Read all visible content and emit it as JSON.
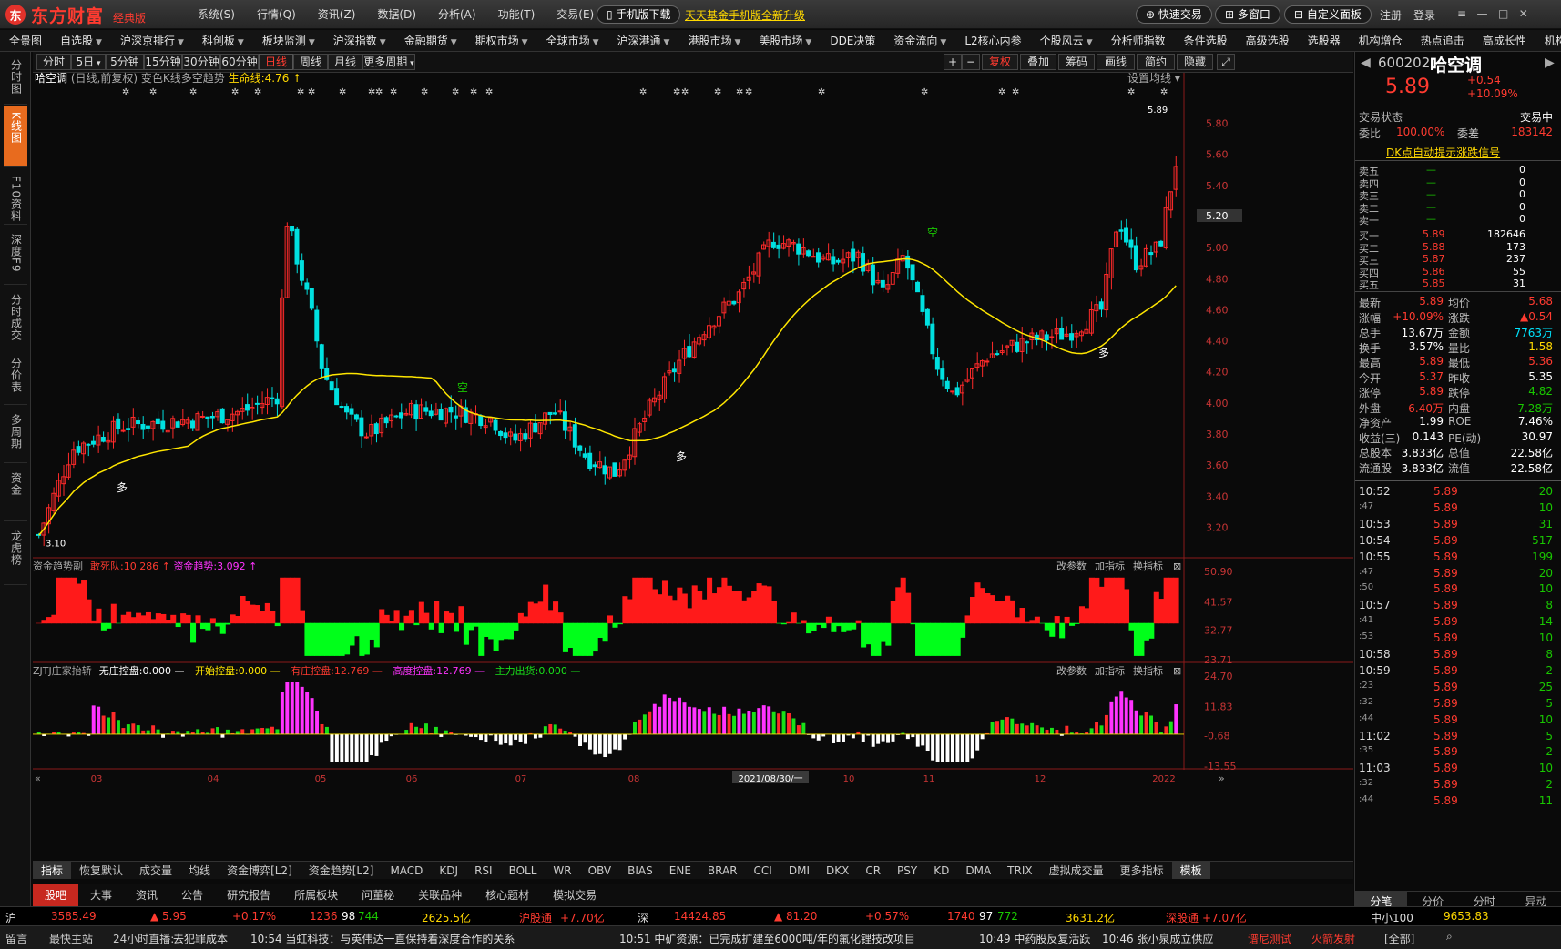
{
  "app": {
    "brand": "东方财富",
    "edition": "经典版"
  },
  "top_menu": [
    "系统(S)",
    "行情(Q)",
    "资讯(Z)",
    "数据(D)",
    "分析(A)",
    "功能(T)",
    "交易(E)",
    "帮助(H)"
  ],
  "top_links": {
    "mobile_download": "手机版下载",
    "fund_upgrade": "天天基金手机版全新升级"
  },
  "top_right": {
    "quick_trade": "快速交易",
    "multi_window": "多窗口",
    "custom_panel": "自定义面板",
    "register": "注册",
    "login": "登录"
  },
  "nav": [
    {
      "label": "全景图",
      "dd": false
    },
    {
      "label": "自选股",
      "dd": true
    },
    {
      "label": "沪深京排行",
      "dd": true
    },
    {
      "label": "科创板",
      "dd": true
    },
    {
      "label": "板块监测",
      "dd": true
    },
    {
      "label": "沪深指数",
      "dd": true
    },
    {
      "label": "金融期货",
      "dd": true
    },
    {
      "label": "期权市场",
      "dd": true
    },
    {
      "label": "全球市场",
      "dd": true
    },
    {
      "label": "沪深港通",
      "dd": true
    },
    {
      "label": "港股市场",
      "dd": true
    },
    {
      "label": "美股市场",
      "dd": true
    },
    {
      "label": "DDE决策",
      "dd": false
    },
    {
      "label": "资金流向",
      "dd": true
    },
    {
      "label": "L2核心内参",
      "dd": false
    },
    {
      "label": "个股风云",
      "dd": true
    },
    {
      "label": "分析师指数",
      "dd": false
    },
    {
      "label": "条件选股",
      "dd": false
    },
    {
      "label": "高级选股",
      "dd": false
    },
    {
      "label": "选股器",
      "dd": false
    },
    {
      "label": "机构增仓",
      "dd": false
    },
    {
      "label": "热点追击",
      "dd": false
    },
    {
      "label": "高成长性",
      "dd": false
    },
    {
      "label": "机构",
      "dd": false
    }
  ],
  "left_tabs": [
    "分时图",
    "K线图",
    "F10资料",
    "深度F9",
    "分时成交",
    "分价表",
    "多周期",
    "资金",
    "龙虎榜"
  ],
  "periods": [
    "分时",
    "5日",
    "5分钟",
    "15分钟",
    "30分钟",
    "60分钟",
    "日线",
    "周线",
    "月线",
    "更多周期"
  ],
  "period_selected": "日线",
  "chart_tools": [
    "复权",
    "叠加",
    "筹码",
    "画线",
    "简约",
    "隐藏"
  ],
  "chart_header": {
    "stock_name": "哈空调",
    "period_info": "(日线,前复权)",
    "indicator": "变色K线多空趋势",
    "life_line_label": "生命线:",
    "life_line_value": "4.76",
    "set_ma": "设置均线"
  },
  "chart_data": [
    {
      "type": "candlestick",
      "name": "main",
      "ylim": [
        3.05,
        5.95
      ],
      "yticks": [
        "5.80",
        "5.60",
        "5.40",
        "5.20",
        "5.00",
        "4.80",
        "4.60",
        "4.40",
        "4.20",
        "4.00",
        "3.80",
        "3.60",
        "3.40",
        "3.20"
      ],
      "xticks": [
        "03",
        "04",
        "05",
        "06",
        "07",
        "08",
        "2021/08/30/一",
        "10",
        "11",
        "12",
        "2022"
      ],
      "last_price_marker": "5.20",
      "hi_label": "5.89",
      "lo_label": "3.10",
      "annotations": [
        "多",
        "空",
        "多",
        "空",
        "多"
      ]
    },
    {
      "type": "area",
      "name": "资金趋势副",
      "legend": [
        {
          "label": "敢死队:",
          "value": "10.286"
        },
        {
          "label": "资金趋势:",
          "value": "3.092"
        }
      ],
      "ylim": [
        23.71,
        50.9
      ],
      "yticks": [
        "50.90",
        "41.57",
        "32.77",
        "23.71"
      ]
    },
    {
      "type": "bar",
      "name": "ZJTJ庄家抬轿",
      "legend": [
        {
          "label": "无庄控盘:",
          "value": "0.000"
        },
        {
          "label": "开始控盘:",
          "value": "0.000"
        },
        {
          "label": "有庄控盘:",
          "value": "12.769"
        },
        {
          "label": "高度控盘:",
          "value": "12.769"
        },
        {
          "label": "主力出货:",
          "value": "0.000"
        }
      ],
      "ylim": [
        -13.55,
        24.7
      ],
      "yticks": [
        "24.70",
        "11.83",
        "-0.68",
        "-13.55"
      ]
    }
  ],
  "sub_buttons": [
    "改参数",
    "加指标",
    "换指标"
  ],
  "indicators": [
    "指标",
    "恢复默认",
    "成交量",
    "均线",
    "资金博弈[L2]",
    "资金趋势[L2]",
    "MACD",
    "KDJ",
    "RSI",
    "BOLL",
    "WR",
    "OBV",
    "BIAS",
    "ENE",
    "BRAR",
    "CCI",
    "DMI",
    "DKX",
    "CR",
    "PSY",
    "KD",
    "DMA",
    "TRIX",
    "虚拟成交量",
    "更多指标",
    "模板"
  ],
  "bottom_tabs": [
    "股吧",
    "大事",
    "资讯",
    "公告",
    "研究报告",
    "所属板块",
    "问董秘",
    "关联品种",
    "核心题材",
    "模拟交易"
  ],
  "quote": {
    "code": "600202",
    "name": "哈空调",
    "price": "5.89",
    "change": "+0.54",
    "change_pct": "+10.09%",
    "trade_status_label": "交易状态",
    "trade_status": "交易中",
    "weibi_label": "委比",
    "weibi": "100.00%",
    "weicha_label": "委差",
    "weicha": "183142",
    "dk_signal": "DK点自动提示涨跌信号",
    "asks": [
      {
        "label": "卖五",
        "price": "—",
        "vol": "0"
      },
      {
        "label": "卖四",
        "price": "—",
        "vol": "0"
      },
      {
        "label": "卖三",
        "price": "—",
        "vol": "0"
      },
      {
        "label": "卖二",
        "price": "—",
        "vol": "0"
      },
      {
        "label": "卖一",
        "price": "—",
        "vol": "0"
      }
    ],
    "bids": [
      {
        "label": "买一",
        "price": "5.89",
        "vol": "182646"
      },
      {
        "label": "买二",
        "price": "5.88",
        "vol": "173"
      },
      {
        "label": "买三",
        "price": "5.87",
        "vol": "237"
      },
      {
        "label": "买四",
        "price": "5.86",
        "vol": "55"
      },
      {
        "label": "买五",
        "price": "5.85",
        "vol": "31"
      }
    ],
    "stats": [
      {
        "l1": "最新",
        "v1": "5.89",
        "c1": "red",
        "l2": "均价",
        "v2": "5.68",
        "c2": "red"
      },
      {
        "l1": "涨幅",
        "v1": "+10.09%",
        "c1": "red",
        "l2": "涨跌",
        "v2": "▲0.54",
        "c2": "red"
      },
      {
        "l1": "总手",
        "v1": "13.67万",
        "c1": "white",
        "l2": "金额",
        "v2": "7763万",
        "c2": "cyan"
      },
      {
        "l1": "换手",
        "v1": "3.57%",
        "c1": "white",
        "l2": "量比",
        "v2": "1.58",
        "c2": "yellow"
      },
      {
        "l1": "最高",
        "v1": "5.89",
        "c1": "red",
        "l2": "最低",
        "v2": "5.36",
        "c2": "red"
      },
      {
        "l1": "今开",
        "v1": "5.37",
        "c1": "red",
        "l2": "昨收",
        "v2": "5.35",
        "c2": "white"
      },
      {
        "l1": "涨停",
        "v1": "5.89",
        "c1": "red",
        "l2": "跌停",
        "v2": "4.82",
        "c2": "green"
      },
      {
        "l1": "外盘",
        "v1": "6.40万",
        "c1": "red",
        "l2": "内盘",
        "v2": "7.28万",
        "c2": "green"
      },
      {
        "l1": "净资产",
        "v1": "1.99",
        "c1": "white",
        "l2": "ROE",
        "v2": "7.46%",
        "c2": "white"
      },
      {
        "l1": "收益(三)",
        "v1": "0.143",
        "c1": "white",
        "l2": "PE(动)",
        "v2": "30.97",
        "c2": "white"
      },
      {
        "l1": "总股本",
        "v1": "3.833亿",
        "c1": "white",
        "l2": "总值",
        "v2": "22.58亿",
        "c2": "white"
      },
      {
        "l1": "流通股",
        "v1": "3.833亿",
        "c1": "white",
        "l2": "流值",
        "v2": "22.58亿",
        "c2": "white"
      }
    ],
    "ticks": [
      {
        "t": "10:52",
        "p": "5.89",
        "v": "20"
      },
      {
        "t": ":47",
        "p": "5.89",
        "v": "10"
      },
      {
        "t": "10:53",
        "p": "5.89",
        "v": "31"
      },
      {
        "t": "10:54",
        "p": "5.89",
        "v": "517"
      },
      {
        "t": "10:55",
        "p": "5.89",
        "v": "199"
      },
      {
        "t": ":47",
        "p": "5.89",
        "v": "20"
      },
      {
        "t": ":50",
        "p": "5.89",
        "v": "10"
      },
      {
        "t": "10:57",
        "p": "5.89",
        "v": "8"
      },
      {
        "t": ":41",
        "p": "5.89",
        "v": "14"
      },
      {
        "t": ":53",
        "p": "5.89",
        "v": "10"
      },
      {
        "t": "10:58",
        "p": "5.89",
        "v": "8"
      },
      {
        "t": "10:59",
        "p": "5.89",
        "v": "2"
      },
      {
        "t": ":23",
        "p": "5.89",
        "v": "25"
      },
      {
        "t": ":32",
        "p": "5.89",
        "v": "5"
      },
      {
        "t": ":44",
        "p": "5.89",
        "v": "10"
      },
      {
        "t": "11:02",
        "p": "5.89",
        "v": "5"
      },
      {
        "t": ":35",
        "p": "5.89",
        "v": "2"
      },
      {
        "t": "11:03",
        "p": "5.89",
        "v": "10"
      },
      {
        "t": ":32",
        "p": "5.89",
        "v": "2"
      },
      {
        "t": ":44",
        "p": "5.89",
        "v": "11"
      }
    ],
    "detail_tabs": [
      "分笔",
      "分价",
      "分时",
      "异动"
    ]
  },
  "status": {
    "sh_label": "沪",
    "sh_index": "3585.49",
    "sh_chg": "▲ 5.95",
    "sh_pct": "+0.17%",
    "sh_up": "1236",
    "sh_flat": "98",
    "sh_down": "744",
    "sh_amt": "2625.5亿",
    "hgt_label": "沪股通",
    "hgt": "+7.70亿",
    "sz_label": "深",
    "sz_index": "14424.85",
    "sz_chg": "▲ 81.20",
    "sz_pct": "+0.57%",
    "sz_up": "1740",
    "sz_flat": "97",
    "sz_down": "772",
    "sz_amt": "3631.2亿",
    "sgt_label": "深股通",
    "sgt": "+7.07亿",
    "zx_label": "中小100",
    "zx": "9653.83"
  },
  "news": {
    "left_items": [
      "留言",
      "最快主站",
      "24小时直播:"
    ],
    "items": [
      "去犯罪成本",
      "10:54 当虹科技：与英伟达一直保持着深度合作的关系",
      "10:51 中矿资源：已完成扩建至6000吨/年的氟化锂技改项目",
      "10:49 中药股反复活跃",
      "10:46 张小泉成立供应"
    ],
    "right_items": [
      "谱尼测试",
      "火箭发射",
      "[全部]"
    ]
  }
}
